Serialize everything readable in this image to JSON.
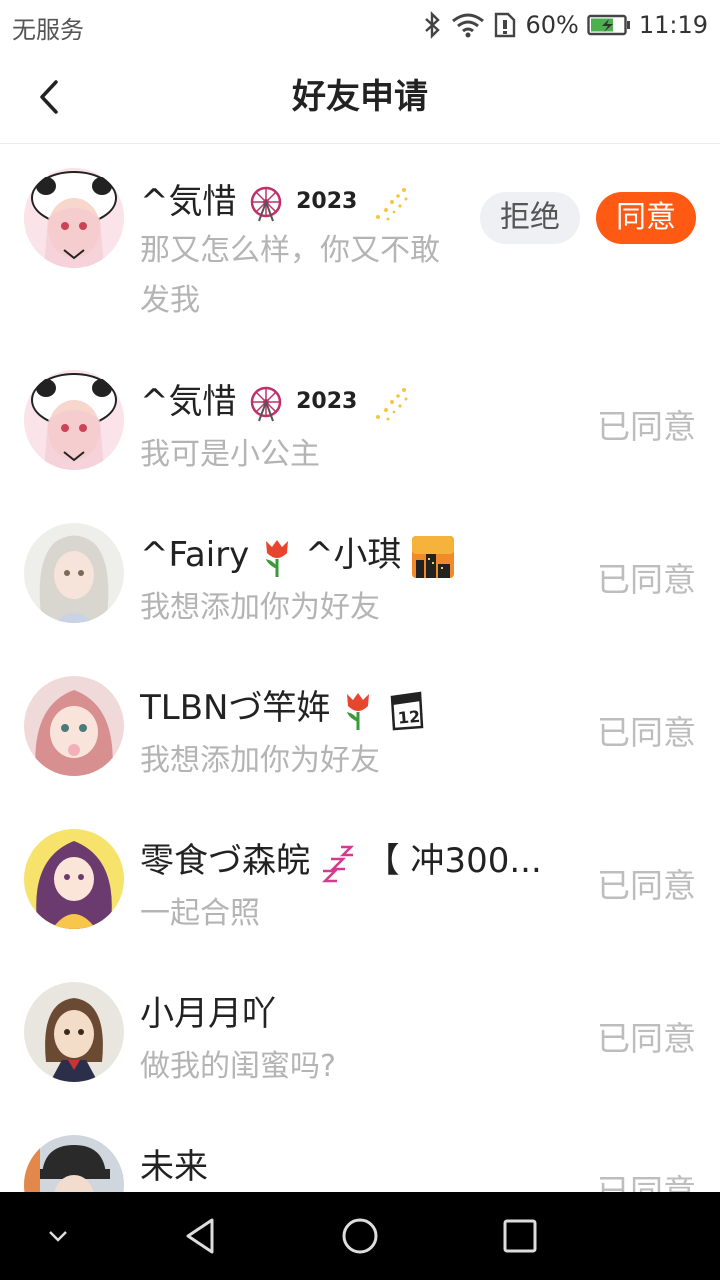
{
  "status_bar": {
    "carrier": "无服务",
    "battery": "60%",
    "time": "11:19"
  },
  "header": {
    "title": "好友申请"
  },
  "requests": [
    {
      "name": "^気惜",
      "badge": "2023",
      "message": "那又怎么样，你又不敢发我",
      "reject_label": "拒绝",
      "accept_label": "同意"
    },
    {
      "name": "^気惜",
      "badge": "2023",
      "message": "我可是小公主",
      "status": "已同意"
    },
    {
      "name": "^Fairy",
      "name_suffix": "^小琪",
      "message": "我想添加你为好友",
      "status": "已同意"
    },
    {
      "name": "TLBNづ竿姩",
      "message": "我想添加你为好友",
      "status": "已同意"
    },
    {
      "name": "零食づ森皖",
      "name_suffix": "【 冲300...",
      "message": "一起合照",
      "status": "已同意"
    },
    {
      "name": "小月月吖",
      "message": "做我的闺蜜吗?",
      "status": "已同意"
    },
    {
      "name": "未来",
      "message": "",
      "status": "已同意"
    }
  ],
  "icons": {
    "back": "chevron-left-icon",
    "bluetooth": "bluetooth-icon",
    "wifi": "wifi-icon",
    "battery": "battery-charging-icon"
  },
  "colors": {
    "accent": "#ff5a14",
    "muted_text": "#b4b4b4"
  }
}
